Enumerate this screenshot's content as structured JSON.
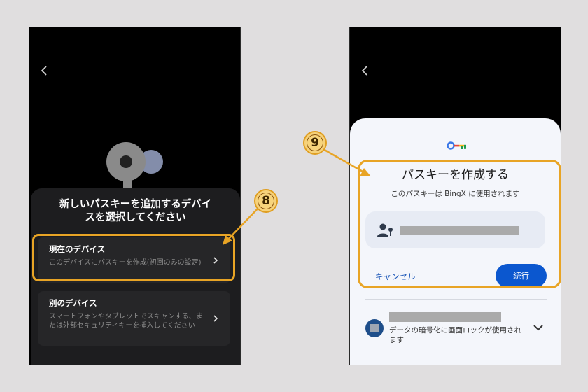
{
  "left_screen": {
    "title": "新しいパスキーを追加するデバイスを選択してください",
    "options": [
      {
        "title": "現在のデバイス",
        "description": "このデバイスにパスキーを作成(初回のみの設定)"
      },
      {
        "title": "別のデバイス",
        "description": "スマートフォンやタブレットでスキャンする、または外部セキュリティキーを挿入してください"
      }
    ],
    "step_badge": "8"
  },
  "right_screen": {
    "title": "パスキーを作成する",
    "subtitle": "このパスキーは BingX に使用されます",
    "cancel_label": "キャンセル",
    "continue_label": "続行",
    "encryption_note": "データの暗号化に画面ロックが使用されます",
    "step_badge": "9"
  },
  "colors": {
    "highlight": "#e8a425",
    "badge_fill": "#f6d27b",
    "primary_button": "#0b57cf",
    "link": "#1a56b8"
  },
  "icons": [
    "back-icon",
    "key-illustration-icon",
    "chevron-right-icon",
    "passkey-logo-icon",
    "person-key-icon",
    "chevron-down-icon"
  ]
}
